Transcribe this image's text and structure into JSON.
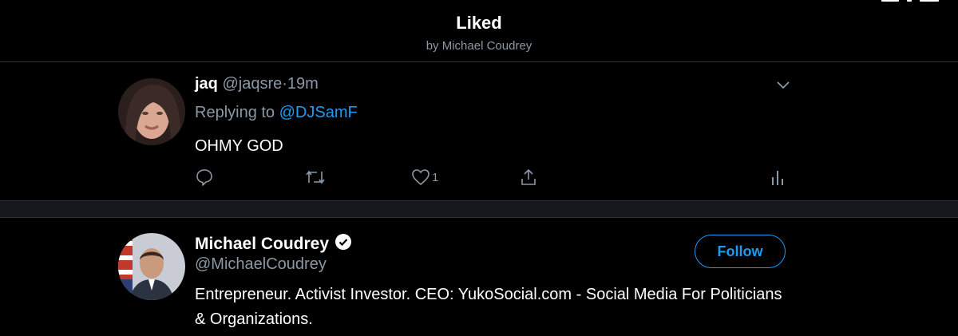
{
  "header": {
    "title": "Liked",
    "subtitle": "by Michael Coudrey"
  },
  "tweet": {
    "name": "jaq",
    "handle": "@jaqsre",
    "separator": "·",
    "time": "19m",
    "replying_prefix": "Replying to",
    "replying_to": "@DJSamF",
    "text": "OHMY GOD",
    "like_count": "1",
    "icons": [
      "reply-icon",
      "retweet-icon",
      "like-icon",
      "share-icon",
      "analytics-icon",
      "chevron-down-icon"
    ]
  },
  "user": {
    "name": "Michael Coudrey",
    "handle": "@MichaelCoudrey",
    "verified": true,
    "follow_label": "Follow",
    "bio": "Entrepreneur. Activist Investor. CEO: YukoSocial.com - Social Media For Politicians & Organizations."
  },
  "colors": {
    "accent": "#1d9bf0",
    "secondary_text": "#8b98a5",
    "background": "#000000"
  }
}
